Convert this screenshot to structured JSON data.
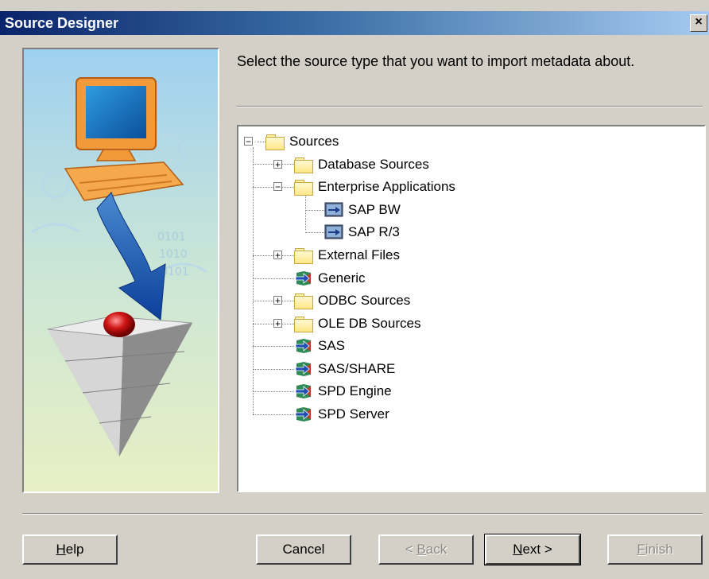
{
  "window": {
    "title": "Source Designer",
    "close_label": "×"
  },
  "instructions": "Select the source type that you want to import metadata about.",
  "tree": {
    "nodes": [
      {
        "label": "Sources"
      },
      {
        "label": "Database Sources"
      },
      {
        "label": "Enterprise Applications"
      },
      {
        "label": "SAP BW"
      },
      {
        "label": "SAP R/3"
      },
      {
        "label": "External Files"
      },
      {
        "label": "Generic"
      },
      {
        "label": "ODBC Sources"
      },
      {
        "label": "OLE DB Sources"
      },
      {
        "label": "SAS"
      },
      {
        "label": "SAS/SHARE"
      },
      {
        "label": "SPD Engine"
      },
      {
        "label": "SPD Server"
      }
    ],
    "expander_minus": "−",
    "expander_plus": "+"
  },
  "buttons": {
    "help": {
      "mnemonic": "H",
      "rest": "elp"
    },
    "cancel": "Cancel",
    "back": {
      "prefix": "< ",
      "mnemonic": "B",
      "rest": "ack"
    },
    "next": {
      "mnemonic": "N",
      "rest": "ext >"
    },
    "finish": {
      "mnemonic": "F",
      "rest": "inish"
    }
  },
  "icons": {
    "folder": "folder-icon",
    "source": "source-arrow-icon",
    "sap": "sap-source-icon",
    "close": "close-icon"
  },
  "colors": {
    "title_start": "#0a246a",
    "title_end": "#a6caf0",
    "dialog_bg": "#d4d0c8",
    "tree_bg": "#ffffff"
  }
}
